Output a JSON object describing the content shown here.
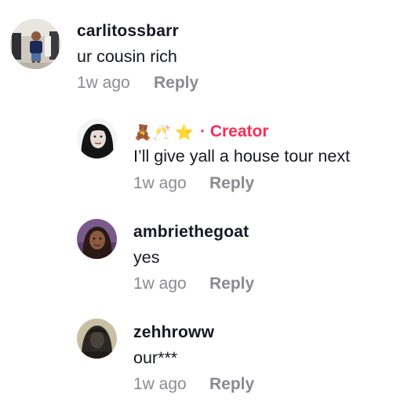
{
  "comments": [
    {
      "username": "carlitossbarr",
      "text": "ur cousin rich",
      "time": "1w ago",
      "reply_label": "Reply"
    },
    {
      "username": "🧸🥂 ⭐",
      "creator_label": "· Creator",
      "text": "I’ll give yall a house tour next",
      "time": "1w ago",
      "reply_label": "Reply"
    },
    {
      "username": "ambriethegoat",
      "text": "yes",
      "time": "1w ago",
      "reply_label": "Reply"
    },
    {
      "username": "zehhroww",
      "text": "our***",
      "time": "1w ago",
      "reply_label": "Reply"
    }
  ],
  "colors": {
    "text": "#161823",
    "muted": "#8a8b91",
    "creator": "#fe2c55",
    "background": "#ffffff"
  }
}
